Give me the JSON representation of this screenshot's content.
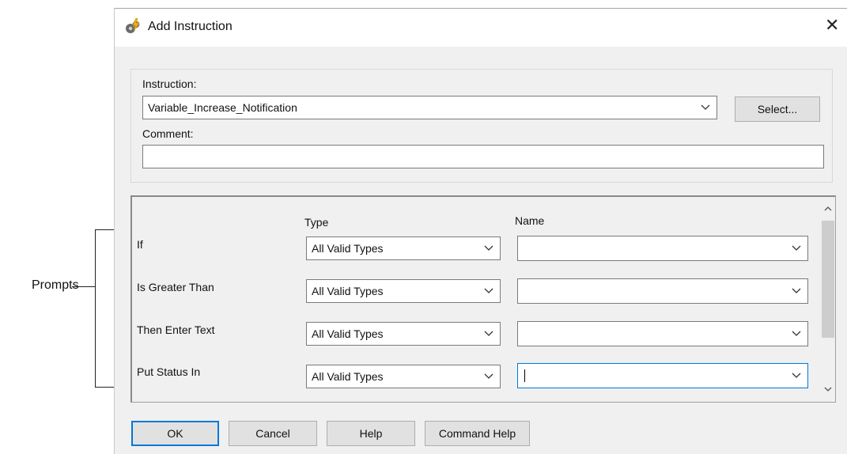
{
  "annotation": {
    "label": "Prompts"
  },
  "window": {
    "title": "Add Instruction",
    "close_glyph": "✕"
  },
  "instruction": {
    "label": "Instruction:",
    "value": "Variable_Increase_Notification",
    "select_button": "Select..."
  },
  "comment": {
    "label": "Comment:",
    "value": ""
  },
  "prompts": {
    "type_header": "Type",
    "name_header": "Name",
    "rows": [
      {
        "label": "If",
        "type": "All Valid Types",
        "name": ""
      },
      {
        "label": "Is Greater Than",
        "type": "All Valid Types",
        "name": ""
      },
      {
        "label": "Then Enter Text",
        "type": "All Valid Types",
        "name": ""
      },
      {
        "label": "Put Status In",
        "type": "All Valid Types",
        "name": ""
      }
    ]
  },
  "buttons": {
    "ok": "OK",
    "cancel": "Cancel",
    "help": "Help",
    "command_help": "Command Help"
  },
  "colors": {
    "focus_border": "#0078d7",
    "dialog_bg": "#f0f0f0"
  },
  "icons": {
    "title": "gears-lightning-icon",
    "dropdown": "chevron-down-icon",
    "scroll_up": "chevron-up-icon",
    "scroll_down": "chevron-down-icon"
  }
}
